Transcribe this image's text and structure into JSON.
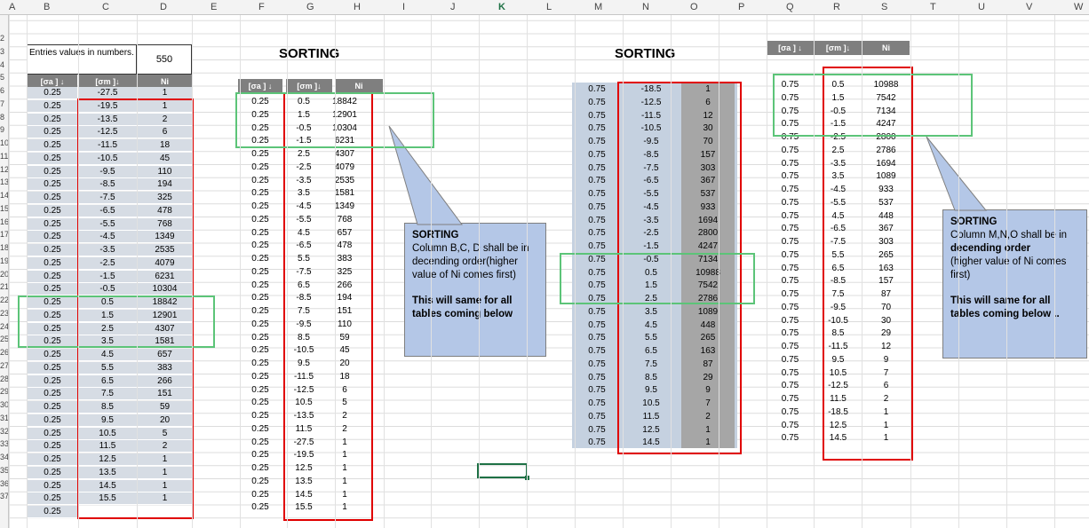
{
  "columns": [
    "A",
    "B",
    "C",
    "D",
    "E",
    "F",
    "G",
    "H",
    "I",
    "J",
    "K",
    "L",
    "M",
    "N",
    "O",
    "P",
    "Q",
    "R",
    "S",
    "T",
    "U",
    "V",
    "W"
  ],
  "selected_column": "K",
  "row_numbers": [
    "2",
    "3",
    "4",
    "5",
    "6",
    "7",
    "8",
    "9",
    "10",
    "11",
    "12",
    "13",
    "14",
    "15",
    "16",
    "17",
    "18",
    "19",
    "20",
    "21",
    "22",
    "23",
    "24",
    "25",
    "26",
    "27",
    "28",
    "29",
    "30",
    "31",
    "32",
    "33",
    "34",
    "35",
    "36",
    "37"
  ],
  "info": {
    "label": "Entries values in numbers.",
    "value": "550"
  },
  "headers": {
    "sa": "[σa ] ↓",
    "sm": "[σm ]↓",
    "ni": "Ni"
  },
  "titles": {
    "t1": "SORTING",
    "t2": "SORTING"
  },
  "table1": {
    "a": [
      "0.25",
      "0.25",
      "0.25",
      "0.25",
      "0.25",
      "0.25",
      "0.25",
      "0.25",
      "0.25",
      "0.25",
      "0.25",
      "0.25",
      "0.25",
      "0.25",
      "0.25",
      "0.25",
      "0.25",
      "0.25",
      "0.25",
      "0.25",
      "0.25",
      "0.25",
      "0.25",
      "0.25",
      "0.25",
      "0.25",
      "0.25",
      "0.25",
      "0.25",
      "0.25",
      "0.25",
      "0.25",
      "0.25"
    ],
    "m": [
      "-27.5",
      "-19.5",
      "-13.5",
      "-12.5",
      "-11.5",
      "-10.5",
      "-9.5",
      "-8.5",
      "-7.5",
      "-6.5",
      "-5.5",
      "-4.5",
      "-3.5",
      "-2.5",
      "-1.5",
      "-0.5",
      "0.5",
      "1.5",
      "2.5",
      "3.5",
      "4.5",
      "5.5",
      "6.5",
      "7.5",
      "8.5",
      "9.5",
      "10.5",
      "11.5",
      "12.5",
      "13.5",
      "14.5",
      "15.5"
    ],
    "n": [
      "1",
      "1",
      "2",
      "6",
      "18",
      "45",
      "110",
      "194",
      "325",
      "478",
      "768",
      "1349",
      "2535",
      "4079",
      "6231",
      "10304",
      "18842",
      "12901",
      "4307",
      "1581",
      "657",
      "383",
      "266",
      "151",
      "59",
      "20",
      "5",
      "2",
      "1",
      "1",
      "1",
      "1"
    ]
  },
  "table2": {
    "a": [
      "0.25",
      "0.25",
      "0.25",
      "0.25",
      "0.25",
      "0.25",
      "0.25",
      "0.25",
      "0.25",
      "0.25",
      "0.25",
      "0.25",
      "0.25",
      "0.25",
      "0.25",
      "0.25",
      "0.25",
      "0.25",
      "0.25",
      "0.25",
      "0.25",
      "0.25",
      "0.25",
      "0.25",
      "0.25",
      "0.25",
      "0.25",
      "0.25",
      "0.25",
      "0.25",
      "0.25",
      "0.25"
    ],
    "m": [
      "0.5",
      "1.5",
      "-0.5",
      "-1.5",
      "2.5",
      "-2.5",
      "-3.5",
      "3.5",
      "-4.5",
      "-5.5",
      "4.5",
      "-6.5",
      "5.5",
      "-7.5",
      "6.5",
      "-8.5",
      "7.5",
      "-9.5",
      "8.5",
      "-10.5",
      "9.5",
      "-11.5",
      "-12.5",
      "10.5",
      "-13.5",
      "11.5",
      "-27.5",
      "-19.5",
      "12.5",
      "13.5",
      "14.5",
      "15.5"
    ],
    "n": [
      "18842",
      "12901",
      "10304",
      "6231",
      "4307",
      "4079",
      "2535",
      "1581",
      "1349",
      "768",
      "657",
      "478",
      "383",
      "325",
      "266",
      "194",
      "151",
      "110",
      "59",
      "45",
      "20",
      "18",
      "6",
      "5",
      "2",
      "2",
      "1",
      "1",
      "1",
      "1",
      "1",
      "1"
    ]
  },
  "table3": {
    "a": [
      "0.75",
      "0.75",
      "0.75",
      "0.75",
      "0.75",
      "0.75",
      "0.75",
      "0.75",
      "0.75",
      "0.75",
      "0.75",
      "0.75",
      "0.75",
      "0.75",
      "0.75",
      "0.75",
      "0.75",
      "0.75",
      "0.75",
      "0.75",
      "0.75",
      "0.75",
      "0.75",
      "0.75",
      "0.75",
      "0.75",
      "0.75",
      "0.75"
    ],
    "m": [
      "-18.5",
      "-12.5",
      "-11.5",
      "-10.5",
      "-9.5",
      "-8.5",
      "-7.5",
      "-6.5",
      "-5.5",
      "-4.5",
      "-3.5",
      "-2.5",
      "-1.5",
      "-0.5",
      "0.5",
      "1.5",
      "2.5",
      "3.5",
      "4.5",
      "5.5",
      "6.5",
      "7.5",
      "8.5",
      "9.5",
      "10.5",
      "11.5",
      "12.5",
      "14.5"
    ],
    "n": [
      "1",
      "6",
      "12",
      "30",
      "70",
      "157",
      "303",
      "367",
      "537",
      "933",
      "1694",
      "2800",
      "4247",
      "7134",
      "10988",
      "7542",
      "2786",
      "1089",
      "448",
      "265",
      "163",
      "87",
      "29",
      "9",
      "7",
      "2",
      "1",
      "1"
    ]
  },
  "table4": {
    "a": [
      "0.75",
      "0.75",
      "0.75",
      "0.75",
      "0.75",
      "0.75",
      "0.75",
      "0.75",
      "0.75",
      "0.75",
      "0.75",
      "0.75",
      "0.75",
      "0.75",
      "0.75",
      "0.75",
      "0.75",
      "0.75",
      "0.75",
      "0.75",
      "0.75",
      "0.75",
      "0.75",
      "0.75",
      "0.75",
      "0.75",
      "0.75",
      "0.75"
    ],
    "m": [
      "0.5",
      "1.5",
      "-0.5",
      "-1.5",
      "-2.5",
      "2.5",
      "-3.5",
      "3.5",
      "-4.5",
      "-5.5",
      "4.5",
      "-6.5",
      "-7.5",
      "5.5",
      "6.5",
      "-8.5",
      "7.5",
      "-9.5",
      "-10.5",
      "8.5",
      "-11.5",
      "9.5",
      "10.5",
      "-12.5",
      "11.5",
      "-18.5",
      "12.5",
      "14.5"
    ],
    "n": [
      "10988",
      "7542",
      "7134",
      "4247",
      "2800",
      "2786",
      "1694",
      "1089",
      "933",
      "537",
      "448",
      "367",
      "303",
      "265",
      "163",
      "157",
      "87",
      "70",
      "30",
      "29",
      "12",
      "9",
      "7",
      "6",
      "2",
      "1",
      "1",
      "1"
    ]
  },
  "callout1": {
    "title": "SORTING",
    "body": "Column B,C, D shall be in decending order(higher value of Ni comes first)",
    "footer": "This will same for all tables  coming below"
  },
  "callout2": {
    "title": "SORTING",
    "body1": "Column M,N,O shall be in",
    "bold": "decending order",
    "body2": "(higher value of Ni comes first)",
    "footer": "This will same for all tables  coming below .."
  },
  "colors": {
    "header_gray": "#7f7f7f",
    "cell_gray": "#d6dce4",
    "red": "#e00000",
    "green": "#5cc478",
    "callout": "#b4c7e7"
  }
}
